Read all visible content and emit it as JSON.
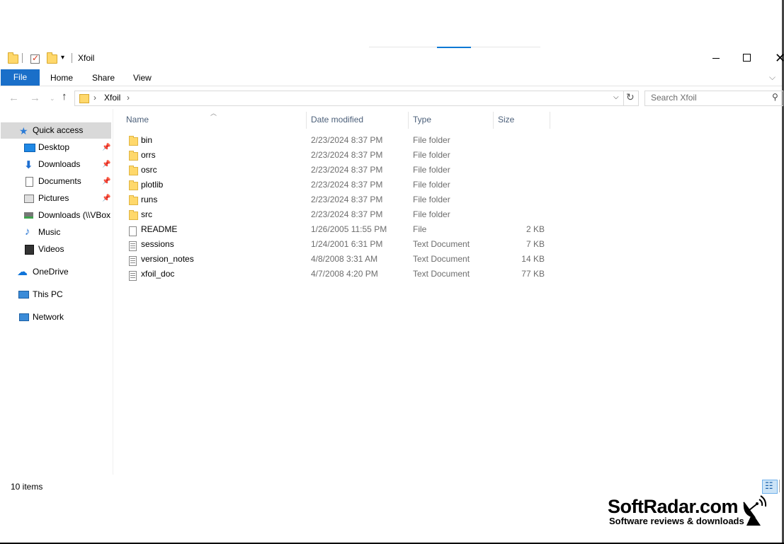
{
  "window": {
    "title": "Xfoil",
    "minimize_icon": "minimize-icon",
    "maximize_icon": "maximize-icon",
    "close_icon": "close-icon"
  },
  "ribbon": {
    "tabs": [
      "File",
      "Home",
      "Share",
      "View"
    ],
    "active_tab": "File",
    "accent": "#1a6fc9"
  },
  "address": {
    "crumbs": [
      "Xfoil"
    ],
    "search_placeholder": "Search Xfoil"
  },
  "nav": {
    "quick_access": "Quick access",
    "items": [
      {
        "label": "Desktop",
        "icon": "desktop-icon",
        "pinned": true
      },
      {
        "label": "Downloads",
        "icon": "download-icon",
        "pinned": true
      },
      {
        "label": "Documents",
        "icon": "documents-icon",
        "pinned": true
      },
      {
        "label": "Pictures",
        "icon": "pictures-icon",
        "pinned": true
      },
      {
        "label": "Downloads (\\\\VBox",
        "icon": "network-drive-icon",
        "pinned": false
      },
      {
        "label": "Music",
        "icon": "music-icon",
        "pinned": false
      },
      {
        "label": "Videos",
        "icon": "videos-icon",
        "pinned": false
      }
    ],
    "onedrive": "OneDrive",
    "this_pc": "This PC",
    "network": "Network"
  },
  "columns": {
    "name": "Name",
    "date": "Date modified",
    "type": "Type",
    "size": "Size"
  },
  "files": [
    {
      "name": "bin",
      "date": "2/23/2024 8:37 PM",
      "type": "File folder",
      "size": "",
      "kind": "folder"
    },
    {
      "name": "orrs",
      "date": "2/23/2024 8:37 PM",
      "type": "File folder",
      "size": "",
      "kind": "folder"
    },
    {
      "name": "osrc",
      "date": "2/23/2024 8:37 PM",
      "type": "File folder",
      "size": "",
      "kind": "folder"
    },
    {
      "name": "plotlib",
      "date": "2/23/2024 8:37 PM",
      "type": "File folder",
      "size": "",
      "kind": "folder"
    },
    {
      "name": "runs",
      "date": "2/23/2024 8:37 PM",
      "type": "File folder",
      "size": "",
      "kind": "folder"
    },
    {
      "name": "src",
      "date": "2/23/2024 8:37 PM",
      "type": "File folder",
      "size": "",
      "kind": "folder"
    },
    {
      "name": "README",
      "date": "1/26/2005 11:55 PM",
      "type": "File",
      "size": "2 KB",
      "kind": "file"
    },
    {
      "name": "sessions",
      "date": "1/24/2001 6:31 PM",
      "type": "Text Document",
      "size": "7 KB",
      "kind": "text"
    },
    {
      "name": "version_notes",
      "date": "4/8/2008 3:31 AM",
      "type": "Text Document",
      "size": "14 KB",
      "kind": "text"
    },
    {
      "name": "xfoil_doc",
      "date": "4/7/2008 4:20 PM",
      "type": "Text Document",
      "size": "77 KB",
      "kind": "text"
    }
  ],
  "status": {
    "item_count": "10 items"
  },
  "watermark": {
    "title": "SoftRadar.com",
    "subtitle": "Software reviews & downloads"
  }
}
